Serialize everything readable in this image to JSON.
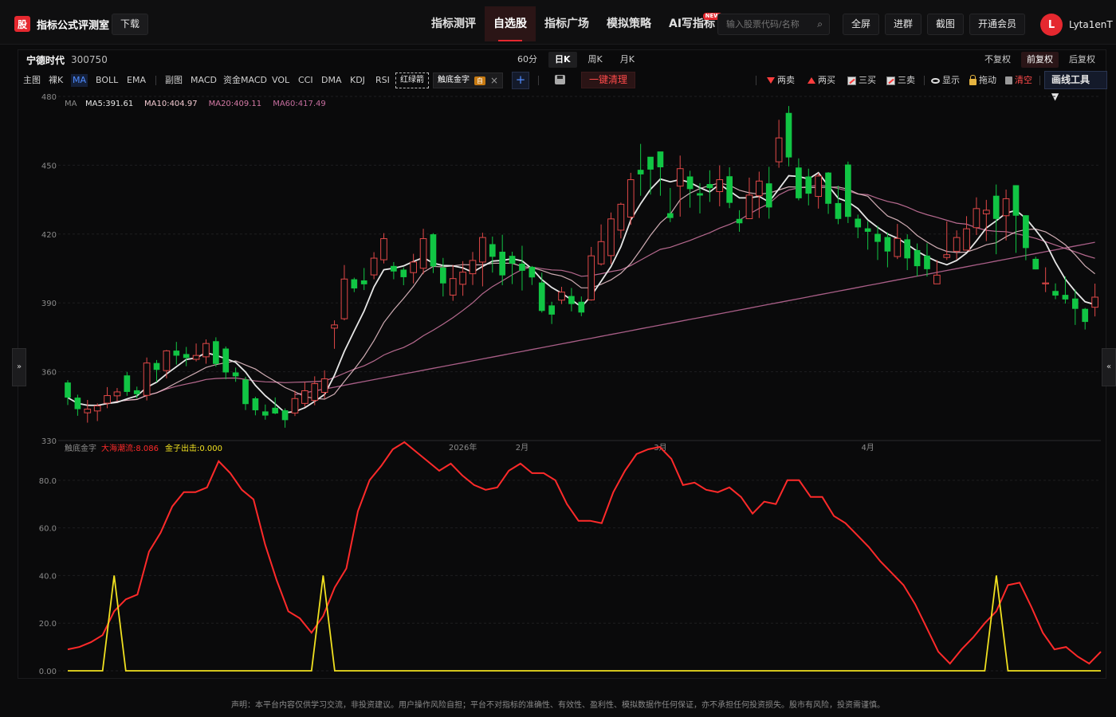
{
  "header": {
    "logo_char": "股",
    "app_title": "指标公式评测室",
    "download_label": "下载",
    "nav": [
      {
        "label": "指标测评",
        "active": false,
        "badge": ""
      },
      {
        "label": "自选股",
        "active": true,
        "badge": ""
      },
      {
        "label": "指标广场",
        "active": false,
        "badge": ""
      },
      {
        "label": "模拟策略",
        "active": false,
        "badge": ""
      },
      {
        "label": "AI写指标",
        "active": false,
        "badge": "NEW"
      }
    ],
    "search_placeholder": "输入股票代码/名称",
    "fullscreen_label": "全屏",
    "join_group_label": "进群",
    "screenshot_label": "截图",
    "vip_label": "开通会员",
    "avatar_letter": "L",
    "username": "Lyta1enT"
  },
  "stock": {
    "name": "宁德时代",
    "code": "300750"
  },
  "periods": [
    {
      "label": "60分",
      "active": false
    },
    {
      "label": "日K",
      "active": true
    },
    {
      "label": "周K",
      "active": false
    },
    {
      "label": "月K",
      "active": false
    }
  ],
  "adjust": [
    {
      "label": "不复权",
      "active": false
    },
    {
      "label": "前复权",
      "active": true
    },
    {
      "label": "后复权",
      "active": false
    }
  ],
  "toolbar": {
    "main_label": "主图",
    "bare_k": "裸K",
    "ma": "MA",
    "boll": "BOLL",
    "ema": "EMA",
    "sub_label": "副图",
    "macd": "MACD",
    "fund_macd": "资金MACD",
    "vol": "VOL",
    "cci": "CCI",
    "dma": "DMA",
    "kdj": "KDJ",
    "rsi": "RSI",
    "red_green_arrow": "红绿箭",
    "custom_indicator": "触底金字",
    "custom_badge": "自",
    "close_x": "×",
    "add": "+",
    "clear_all": "一键清理",
    "two_sell": "两卖",
    "two_buy": "两买",
    "three_buy": "三买",
    "three_sell": "三卖",
    "show": "显示",
    "drag": "拖动",
    "clear": "清空",
    "draw_tools": "画线工具 ▼"
  },
  "side_tabs": {
    "left": "»",
    "right": "«"
  },
  "disclaimer": "声明：本平台内容仅供学习交流，非投资建议。用户操作风险自担；平台不对指标的准确性、有效性、盈利性、模拟数据作任何保证，亦不承担任何投资损失。股市有风险，投资需谨慎。",
  "chart_data": [
    {
      "type": "candlestick",
      "title": "",
      "legend": {
        "prefix": "MA",
        "items": [
          {
            "label": "MA5:391.61",
            "color": "#e6e6e6"
          },
          {
            "label": "MA10:404.97",
            "color": "#f2c9d1"
          },
          {
            "label": "MA20:409.11",
            "color": "#d57aa6"
          },
          {
            "label": "MA60:417.49",
            "color": "#c56d9e"
          }
        ]
      },
      "ylim": [
        330,
        480
      ],
      "y_ticks": [
        480,
        450,
        420,
        390,
        360,
        330
      ],
      "x_labels": [
        {
          "label": "2026年",
          "index": 40
        },
        {
          "label": "2月",
          "index": 46
        },
        {
          "label": "3月",
          "index": 60
        },
        {
          "label": "4月",
          "index": 81
        }
      ],
      "colors": {
        "up": "#e04848",
        "down": "#11c544"
      },
      "candles": [
        [
          355.3,
          348.7,
          356.3,
          345.5
        ],
        [
          348.7,
          343.7,
          350.0,
          340.8
        ],
        [
          342.1,
          343.7,
          347.7,
          337.8
        ],
        [
          342.9,
          345.1,
          346.2,
          338.5
        ],
        [
          346.3,
          349.6,
          353.3,
          344.1
        ],
        [
          349.5,
          351.2,
          352.9,
          347.1
        ],
        [
          358.4,
          351.2,
          359.9,
          349.5
        ],
        [
          351.9,
          350.2,
          353.5,
          348.4
        ],
        [
          349.7,
          363.8,
          366.2,
          347.5
        ],
        [
          363.8,
          360.8,
          365.1,
          355.5
        ],
        [
          360.5,
          369.1,
          369.5,
          357.1
        ],
        [
          369.2,
          367.0,
          373.0,
          363.1
        ],
        [
          367.7,
          366.0,
          370.8,
          362.4
        ],
        [
          365.4,
          367.1,
          372.3,
          364.5
        ],
        [
          366.5,
          372.3,
          374.1,
          363.5
        ],
        [
          373.3,
          363.4,
          375.0,
          362.2
        ],
        [
          370.1,
          359.7,
          371.0,
          356.7
        ],
        [
          359.7,
          358.0,
          361.8,
          355.6
        ],
        [
          356.6,
          345.9,
          357.8,
          343.3
        ],
        [
          348.4,
          343.2,
          349.1,
          341.0
        ],
        [
          342.7,
          340.9,
          345.7,
          339.1
        ],
        [
          344.3,
          341.8,
          348.8,
          341.5
        ],
        [
          343.2,
          338.9,
          344.0,
          335.6
        ],
        [
          342.0,
          348.3,
          351.7,
          340.7
        ],
        [
          346.2,
          351.7,
          355.5,
          344.7
        ],
        [
          347.5,
          354.8,
          358.0,
          345.4
        ],
        [
          351.0,
          356.9,
          360.6,
          348.2
        ],
        [
          379.0,
          380.4,
          382.4,
          370.0
        ],
        [
          383.1,
          400.4,
          406.5,
          382.4
        ],
        [
          400.3,
          396.3,
          401.0,
          394.7
        ],
        [
          399.8,
          398.1,
          405.2,
          395.6
        ],
        [
          402.2,
          409.5,
          412.1,
          400.3
        ],
        [
          408.8,
          418.0,
          420.4,
          407.2
        ],
        [
          406.1,
          403.7,
          407.8,
          400.3
        ],
        [
          404.5,
          401.2,
          405.5,
          397.7
        ],
        [
          403.2,
          407.8,
          411.4,
          398.5
        ],
        [
          405.1,
          418.0,
          422.3,
          402.5
        ],
        [
          419.9,
          405.9,
          420.4,
          403.0
        ],
        [
          405.4,
          398.5,
          409.6,
          392.8
        ],
        [
          393.4,
          400.6,
          406.5,
          390.9
        ],
        [
          398.1,
          403.4,
          408.2,
          393.1
        ],
        [
          402.7,
          408.5,
          412.2,
          397.8
        ],
        [
          407.8,
          418.5,
          420.6,
          397.2
        ],
        [
          415.6,
          410.1,
          418.9,
          403.2
        ],
        [
          412.3,
          402.0,
          419.7,
          397.7
        ],
        [
          410.5,
          407.1,
          412.3,
          398.2
        ],
        [
          407.1,
          404.0,
          414.9,
          395.4
        ],
        [
          405.7,
          401.1,
          406.1,
          397.8
        ],
        [
          398.9,
          386.5,
          403.2,
          385.8
        ],
        [
          388.9,
          384.9,
          390.5,
          380.8
        ],
        [
          391.2,
          394.7,
          397.0,
          389.5
        ],
        [
          393.0,
          389.5,
          396.5,
          386.3
        ],
        [
          390.5,
          385.8,
          392.8,
          384.2
        ],
        [
          391.3,
          410.5,
          414.4,
          391.0
        ],
        [
          407.0,
          416.7,
          424.2,
          406.3
        ],
        [
          410.6,
          426.6,
          429.4,
          406.9
        ],
        [
          421.7,
          433.0,
          433.7,
          418.1
        ],
        [
          427.4,
          443.7,
          446.7,
          424.0
        ],
        [
          448.0,
          446.0,
          459.3,
          436.7
        ],
        [
          453.7,
          448.1,
          451.0,
          437.2
        ],
        [
          456.0,
          449.1,
          452.0,
          436.7
        ],
        [
          429.1,
          427.0,
          440.1,
          425.2
        ],
        [
          440.9,
          448.5,
          454.2,
          427.6
        ],
        [
          445.1,
          439.6,
          447.6,
          431.5
        ],
        [
          437.8,
          436.8,
          442.2,
          429.0
        ],
        [
          441.8,
          440.0,
          447.8,
          434.0
        ],
        [
          438.5,
          443.7,
          449.9,
          432.1
        ],
        [
          445.2,
          433.6,
          449.1,
          431.3
        ],
        [
          426.6,
          424.7,
          430.4,
          421.0
        ],
        [
          426.7,
          437.0,
          444.6,
          428.2
        ],
        [
          436.7,
          443.1,
          447.2,
          427.0
        ],
        [
          442.1,
          431.6,
          449.3,
          426.7
        ],
        [
          451.5,
          461.9,
          469.8,
          448.9
        ],
        [
          472.8,
          453.4,
          475.8,
          449.5
        ],
        [
          449.0,
          435.6,
          453.0,
          434.7
        ],
        [
          445.1,
          437.6,
          448.5,
          432.5
        ],
        [
          436.4,
          445.3,
          446.6,
          431.1
        ],
        [
          446.8,
          433.2,
          447.0,
          428.8
        ],
        [
          433.5,
          426.6,
          441.1,
          424.3
        ],
        [
          450.3,
          427.5,
          451.6,
          424.8
        ],
        [
          426.7,
          422.9,
          428.5,
          418.2
        ],
        [
          422.5,
          421.0,
          425.6,
          413.2
        ],
        [
          420.1,
          416.6,
          423.6,
          408.7
        ],
        [
          418.7,
          412.4,
          420.7,
          405.5
        ],
        [
          410.2,
          418.1,
          424.4,
          409.1
        ],
        [
          417.7,
          409.4,
          419.9,
          404.3
        ],
        [
          413.0,
          406.0,
          415.9,
          401.6
        ],
        [
          410.6,
          404.7,
          416.0,
          401.5
        ],
        [
          398.3,
          402.1,
          408.7,
          398.4
        ],
        [
          409.8,
          411.0,
          425.5,
          408.7
        ],
        [
          412.5,
          418.5,
          421.6,
          408.9
        ],
        [
          413.0,
          422.3,
          427.8,
          412.9
        ],
        [
          422.8,
          431.1,
          436.0,
          419.6
        ],
        [
          428.8,
          430.4,
          434.9,
          416.9
        ],
        [
          436.7,
          426.6,
          441.6,
          411.2
        ],
        [
          428.0,
          435.4,
          439.4,
          417.2
        ],
        [
          441.3,
          428.0,
          441.3,
          411.8
        ],
        [
          428.2,
          413.9,
          428.2,
          408.6
        ],
        [
          409.2,
          404.6,
          410.1,
          404.6
        ],
        [
          398.3,
          398.7,
          405.5,
          394.7
        ],
        [
          395.2,
          393.2,
          398.5,
          391.6
        ],
        [
          393.5,
          391.5,
          401.5,
          389.7
        ],
        [
          391.9,
          387.4,
          395.8,
          380.4
        ],
        [
          387.4,
          381.7,
          387.8,
          378.4
        ],
        [
          388.1,
          392.5,
          398.4,
          384.1
        ]
      ],
      "note": "candles are [open, close, high, low]"
    },
    {
      "type": "line",
      "title": "",
      "legend": {
        "prefix": "触底金字",
        "items": [
          {
            "label": "大海潮流:8.086",
            "color": "#ff2a2a"
          },
          {
            "label": "金子出击:0.000",
            "color": "#f0e020"
          }
        ]
      },
      "ylim": [
        0,
        95
      ],
      "y_ticks": [
        0,
        20,
        40,
        60,
        80
      ],
      "y_tick_labels": [
        "0.00",
        "20.0",
        "40.0",
        "60.0",
        "80.0"
      ],
      "series": [
        {
          "name": "大海潮流",
          "color": "#ff2a2a",
          "values": [
            9,
            10,
            12,
            15,
            25,
            30,
            32,
            50,
            58,
            69,
            75,
            75,
            77,
            88,
            83,
            76,
            72,
            53,
            38,
            25,
            22,
            16,
            23,
            35,
            43,
            67,
            80,
            86,
            93,
            96,
            92,
            88,
            84,
            87,
            82,
            78,
            76,
            77,
            84,
            87,
            83,
            83,
            80,
            70,
            63,
            63,
            62,
            75,
            84,
            91,
            93,
            94,
            89,
            78,
            79,
            76,
            75,
            77,
            73,
            66,
            71,
            70,
            80,
            80,
            73,
            73,
            65,
            62,
            57,
            52,
            46,
            41,
            36,
            28,
            18,
            8,
            3,
            9,
            14,
            20,
            25,
            36,
            37,
            27,
            16,
            9,
            10,
            6,
            3,
            8
          ]
        },
        {
          "name": "金子出击",
          "color": "#f0e020",
          "values": [
            0,
            0,
            0,
            0,
            40,
            0,
            0,
            0,
            0,
            0,
            0,
            0,
            0,
            0,
            0,
            0,
            0,
            0,
            0,
            0,
            0,
            0,
            40,
            0,
            0,
            0,
            0,
            0,
            0,
            0,
            0,
            0,
            0,
            0,
            0,
            0,
            0,
            0,
            0,
            0,
            0,
            0,
            0,
            0,
            0,
            0,
            0,
            0,
            0,
            0,
            0,
            0,
            0,
            0,
            0,
            0,
            0,
            0,
            0,
            0,
            0,
            0,
            0,
            0,
            0,
            0,
            0,
            0,
            0,
            0,
            0,
            0,
            0,
            0,
            0,
            0,
            0,
            0,
            0,
            0,
            40,
            0,
            0,
            0,
            0,
            0,
            0,
            0,
            0,
            0
          ]
        }
      ]
    }
  ]
}
